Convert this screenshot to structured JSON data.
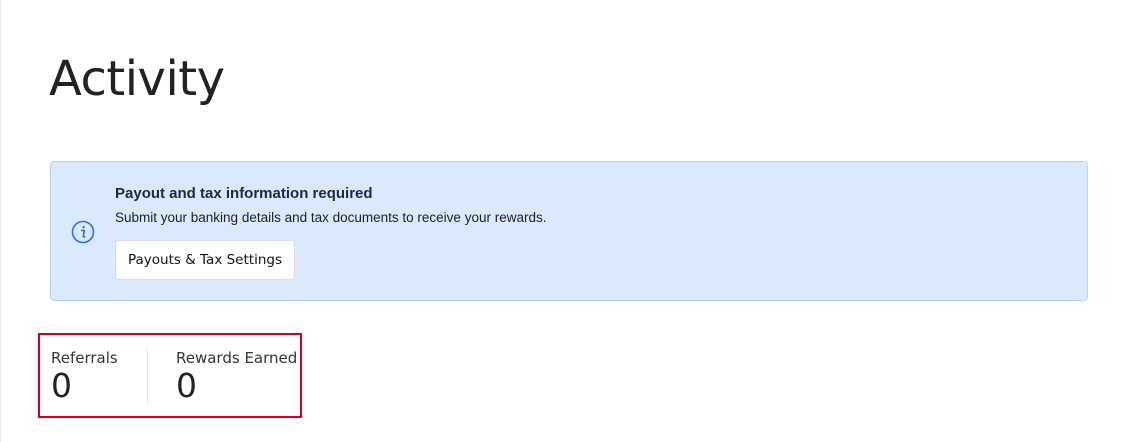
{
  "page": {
    "title": "Activity"
  },
  "alert": {
    "icon": "info-icon",
    "title": "Payout and tax information required",
    "description": "Submit your banking details and tax documents to receive your rewards.",
    "button_label": "Payouts & Tax Settings",
    "colors": {
      "background": "#dbe9fd",
      "border": "#b9d2f3",
      "icon": "#2f6fd6"
    }
  },
  "stats": [
    {
      "label": "Referrals",
      "value": "0"
    },
    {
      "label": "Rewards Earned",
      "value": "0"
    }
  ],
  "highlight": {
    "color": "#d0021b"
  }
}
